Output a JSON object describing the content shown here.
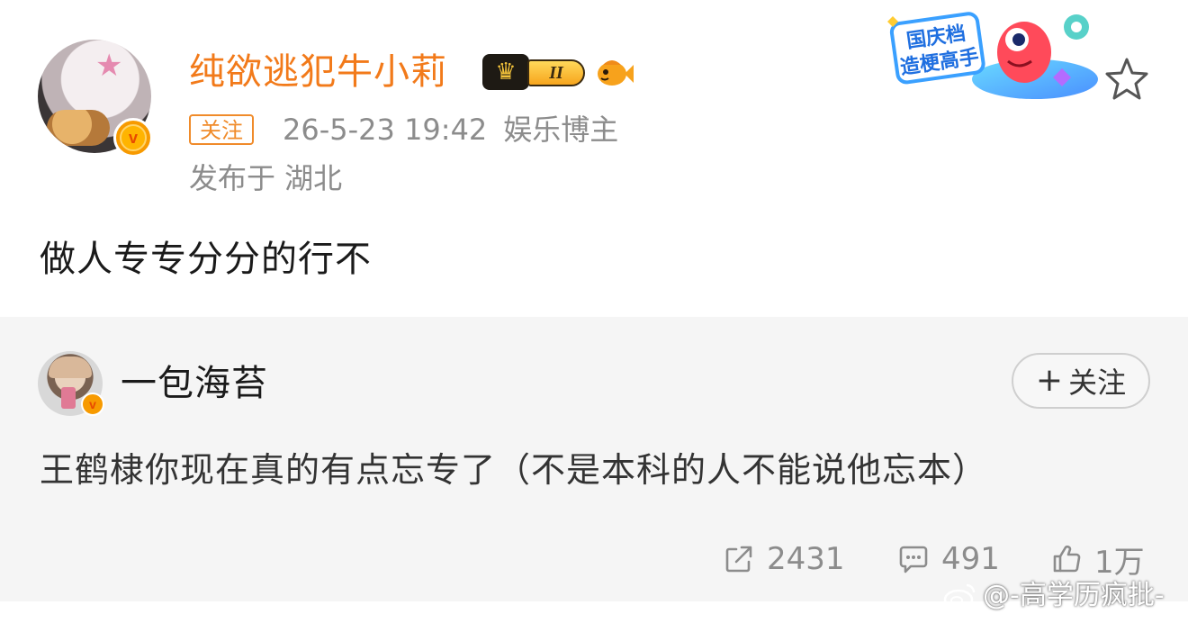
{
  "post": {
    "author": "纯欲逃犯牛小莉",
    "level_label": "II",
    "follow_label": "关注",
    "timestamp": "26-5-23 19:42",
    "role": "娱乐博主",
    "location": "发布于 湖北",
    "text": "做人专专分分的行不",
    "promo_line1": "国庆档",
    "promo_line2": "造梗高手",
    "verified_mark": "v"
  },
  "repost": {
    "author": "一包海苔",
    "verified_mark": "v",
    "follow_button": "关注",
    "follow_plus": "+",
    "text": "王鹤棣你现在真的有点忘专了（不是本科的人不能说他忘本）",
    "actions": {
      "shares": "2431",
      "comments": "491",
      "likes": "1万"
    }
  },
  "watermark": "@-高学历疯批-",
  "colors": {
    "username": "#f27a1a",
    "follow_tag": "#f08b2a",
    "meta_gray": "#8c8c8c",
    "repost_bg": "#f5f5f5",
    "verified_orange": "#f79a00"
  },
  "icons": {
    "share": "share-icon",
    "comment": "comment-icon",
    "like": "thumbs-up-icon",
    "favorite": "star-outline-icon",
    "level": "crown-icon",
    "fish": "fish-badge-icon"
  }
}
